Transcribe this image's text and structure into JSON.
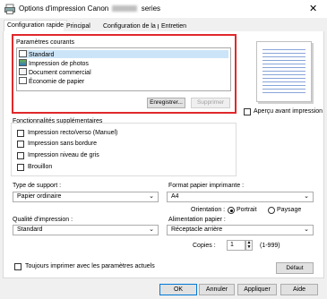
{
  "window": {
    "title_prefix": "Options d'impression Canon",
    "title_suffix": "series",
    "close_glyph": "✕"
  },
  "tabs": [
    {
      "label": "Configuration rapide"
    },
    {
      "label": "Principal"
    },
    {
      "label": "Configuration de la page"
    },
    {
      "label": "Entretien"
    }
  ],
  "presets": {
    "group_label": "Paramètres courants",
    "items": [
      {
        "label": "Standard",
        "icon": "standard-icon"
      },
      {
        "label": "Impression de photos",
        "icon": "photo-icon"
      },
      {
        "label": "Document commercial",
        "icon": "document-icon"
      },
      {
        "label": "Économie de papier",
        "icon": "paper-saving-icon"
      }
    ],
    "save_label": "Enregistrer...",
    "delete_label": "Supprimer"
  },
  "preview": {
    "label": "Aperçu avant impression"
  },
  "features": {
    "group_label": "Fonctionnalités supplémentaires",
    "items": [
      {
        "label": "Impression recto/verso (Manuel)"
      },
      {
        "label": "Impression sans bordure"
      },
      {
        "label": "Impression niveau de gris"
      },
      {
        "label": "Brouillon"
      }
    ]
  },
  "media": {
    "label": "Type de support :",
    "value": "Papier ordinaire"
  },
  "paper_size": {
    "label": "Format papier imprimante :",
    "value": "A4"
  },
  "orientation": {
    "label": "Orientation :",
    "portrait": "Portrait",
    "landscape": "Paysage"
  },
  "quality": {
    "label": "Qualité d'impression :",
    "value": "Standard"
  },
  "paper_source": {
    "label": "Alimentation papier :",
    "value": "Réceptacle arrière"
  },
  "copies": {
    "label": "Copies :",
    "value": "1",
    "range": "(1-999)"
  },
  "always_print": {
    "label": "Toujours imprimer avec les paramètres actuels"
  },
  "default_label": "Défaut",
  "footer": {
    "ok": "OK",
    "cancel": "Annuler",
    "apply": "Appliquer",
    "help": "Aide"
  },
  "chevron": "⌄"
}
